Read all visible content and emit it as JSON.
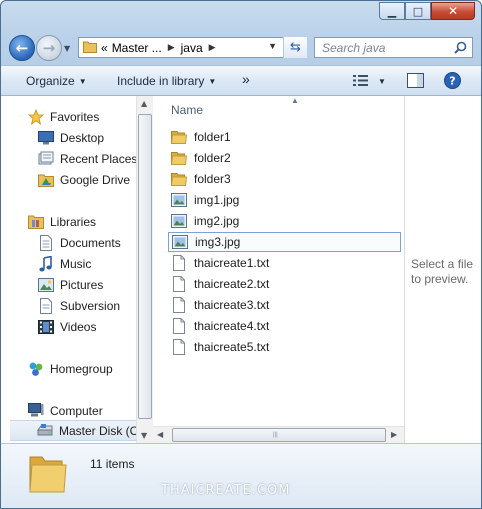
{
  "window": {
    "caption_buttons": {
      "minimize": "▁",
      "maximize": "□",
      "close": "✕"
    }
  },
  "address_bar": {
    "overflow": "«",
    "crumbs": [
      "Master ...",
      "java"
    ],
    "search_placeholder": "Search java"
  },
  "toolbar": {
    "organize": "Organize",
    "include_in_library": "Include in library",
    "more": "»"
  },
  "nav_pane": {
    "favorites": {
      "label": "Favorites",
      "items": [
        "Desktop",
        "Recent Places",
        "Google Drive"
      ]
    },
    "libraries": {
      "label": "Libraries",
      "items": [
        "Documents",
        "Music",
        "Pictures",
        "Subversion",
        "Videos"
      ]
    },
    "homegroup": "Homegroup",
    "computer": {
      "label": "Computer",
      "items": [
        "Master Disk (C"
      ]
    }
  },
  "file_list": {
    "column_header": "Name",
    "items": [
      {
        "name": "folder1",
        "type": "folder"
      },
      {
        "name": "folder2",
        "type": "folder"
      },
      {
        "name": "folder3",
        "type": "folder"
      },
      {
        "name": "img1.jpg",
        "type": "image"
      },
      {
        "name": "img2.jpg",
        "type": "image"
      },
      {
        "name": "img3.jpg",
        "type": "image",
        "focused": true
      },
      {
        "name": "thaicreate1.txt",
        "type": "text"
      },
      {
        "name": "thaicreate2.txt",
        "type": "text"
      },
      {
        "name": "thaicreate3.txt",
        "type": "text"
      },
      {
        "name": "thaicreate4.txt",
        "type": "text"
      },
      {
        "name": "thaicreate5.txt",
        "type": "text"
      }
    ]
  },
  "preview_pane": {
    "text": "Select a file to preview."
  },
  "details_pane": {
    "item_count": "11 items"
  },
  "watermark": "THAICREATE.COM",
  "colors": {
    "folder": "#e8c15a",
    "accent": "#2a66b8"
  }
}
